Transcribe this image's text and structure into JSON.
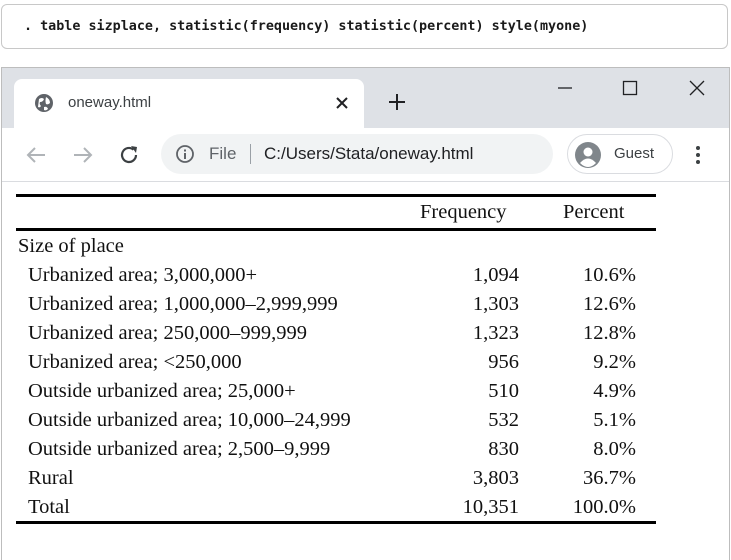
{
  "command": ". table sizplace, statistic(frequency) statistic(percent) style(myone)",
  "browser": {
    "tab_title": "oneway.html",
    "new_tab_symbol": "+",
    "omnibox": {
      "scheme_label": "File",
      "url": "C:/Users/Stata/oneway.html"
    },
    "profile_label": "Guest",
    "icons": [
      "globe-icon",
      "close-icon",
      "plus-icon",
      "minimize-icon",
      "maximize-icon",
      "window-close-icon",
      "back-arrow-icon",
      "forward-arrow-icon",
      "reload-icon",
      "info-icon",
      "avatar-icon",
      "kebab-menu-icon"
    ]
  },
  "table": {
    "headers": {
      "frequency": "Frequency",
      "percent": "Percent"
    },
    "group_label": "Size of place",
    "rows": [
      {
        "label": "Urbanized area; 3,000,000+",
        "frequency": "1,094",
        "percent": "10.6%"
      },
      {
        "label": "Urbanized area; 1,000,000–2,999,999",
        "frequency": "1,303",
        "percent": "12.6%"
      },
      {
        "label": "Urbanized area; 250,000–999,999",
        "frequency": "1,323",
        "percent": "12.8%"
      },
      {
        "label": "Urbanized area; <250,000",
        "frequency": "956",
        "percent": "9.2%"
      },
      {
        "label": "Outside urbanized area; 25,000+",
        "frequency": "510",
        "percent": "4.9%"
      },
      {
        "label": "Outside urbanized area; 10,000–24,999",
        "frequency": "532",
        "percent": "5.1%"
      },
      {
        "label": "Outside urbanized area; 2,500–9,999",
        "frequency": "830",
        "percent": "8.0%"
      },
      {
        "label": "Rural",
        "frequency": "3,803",
        "percent": "36.7%"
      },
      {
        "label": "Total",
        "frequency": "10,351",
        "percent": "100.0%"
      }
    ]
  }
}
